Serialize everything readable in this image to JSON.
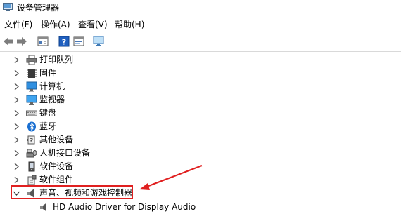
{
  "window": {
    "title": "设备管理器"
  },
  "menu": [
    {
      "label": "文件(F)"
    },
    {
      "label": "操作(A)"
    },
    {
      "label": "查看(V)"
    },
    {
      "label": "帮助(H)"
    }
  ],
  "toolbar": {
    "buttons": [
      "back-icon",
      "forward-icon",
      "properties-icon",
      "help-icon",
      "update-driver-icon",
      "monitor-icon"
    ]
  },
  "tree": {
    "items": [
      {
        "label": "打印队列",
        "icon": "print-queue-icon",
        "expanded": false
      },
      {
        "label": "固件",
        "icon": "firmware-icon",
        "expanded": false
      },
      {
        "label": "计算机",
        "icon": "computer-icon",
        "expanded": false
      },
      {
        "label": "监视器",
        "icon": "monitor-icon",
        "expanded": false
      },
      {
        "label": "键盘",
        "icon": "keyboard-icon",
        "expanded": false
      },
      {
        "label": "蓝牙",
        "icon": "bluetooth-icon",
        "expanded": false
      },
      {
        "label": "其他设备",
        "icon": "other-devices-icon",
        "expanded": false
      },
      {
        "label": "人机接口设备",
        "icon": "hid-icon",
        "expanded": false
      },
      {
        "label": "软件设备",
        "icon": "software-device-icon",
        "expanded": false
      },
      {
        "label": "软件组件",
        "icon": "software-component-icon",
        "expanded": false
      },
      {
        "label": "声音、视频和游戏控制器",
        "icon": "speaker-icon",
        "expanded": true
      }
    ],
    "children": [
      {
        "label": "HD Audio Driver for Display Audio",
        "icon": "speaker-icon"
      }
    ]
  },
  "colors": {
    "annotation": "#e02020",
    "bluetooth": "#1a6fd1",
    "monitor": "#2f8fe0"
  }
}
